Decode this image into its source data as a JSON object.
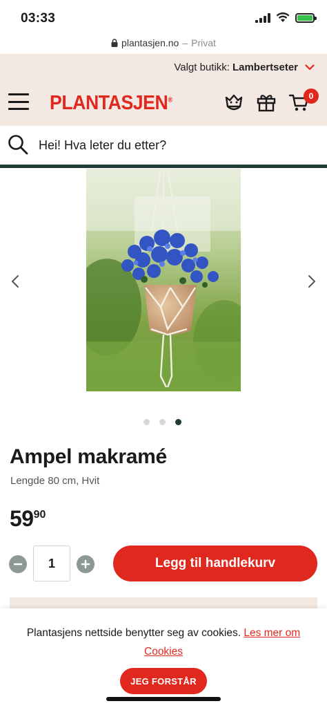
{
  "status_bar": {
    "time": "03:33"
  },
  "url_bar": {
    "domain": "plantasjen.no",
    "separator": "–",
    "mode": "Privat"
  },
  "store": {
    "label": "Valgt butikk:",
    "name": "Lambertseter"
  },
  "header": {
    "logo": "PLANTASJEN",
    "cart_count": "0",
    "icons": [
      "menu-icon",
      "crown-icon",
      "gift-icon",
      "cart-icon"
    ]
  },
  "search": {
    "placeholder": "Hei! Hva leter du etter?"
  },
  "carousel": {
    "slide_count": 3,
    "active_index": 2
  },
  "product": {
    "title": "Ampel makramé",
    "subtitle": "Lengde 80 cm, Hvit",
    "price_main": "59",
    "price_decimal": "90",
    "quantity": "1",
    "add_to_cart_label": "Legg til handlekurv"
  },
  "cookie": {
    "text": "Plantasjens nettside benytter seg av cookies.",
    "link_label": "Les mer om Cookies",
    "accept_label": "JEG FORSTÅR"
  },
  "colors": {
    "brand_red": "#e0281f",
    "brand_green": "#1f3d36",
    "header_bg": "#f3e8e2"
  }
}
